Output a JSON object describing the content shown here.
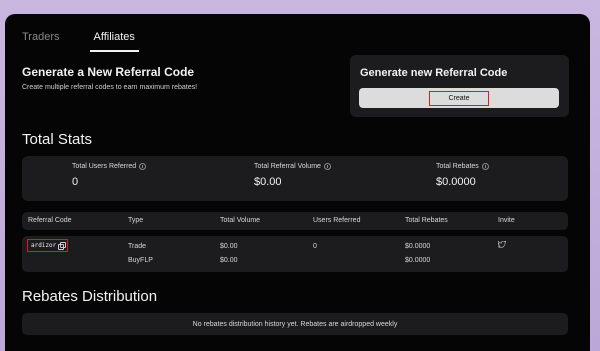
{
  "tabs": {
    "traders": "Traders",
    "affiliates": "Affiliates"
  },
  "generate": {
    "title": "Generate a New Referral Code",
    "subtitle": "Create multiple referral codes to earn maximum rebates!",
    "card_title": "Generate new Referral Code",
    "button_label": "Create"
  },
  "stats": {
    "title": "Total Stats",
    "items": [
      {
        "label": "Total Users Referred",
        "value": "0"
      },
      {
        "label": "Total Referral Volume",
        "value": "$0.00"
      },
      {
        "label": "Total Rebates",
        "value": "$0.0000"
      }
    ]
  },
  "table": {
    "headers": [
      "Referral Code",
      "Type",
      "Total Volume",
      "Users Referred",
      "Total Rebates",
      "Invite"
    ],
    "row": {
      "code": "ardizor",
      "types": [
        "Trade",
        "BuyFLP"
      ],
      "volumes": [
        "$0.00",
        "$0.00"
      ],
      "users": "0",
      "rebates": [
        "$0.0000",
        "$0.0000"
      ],
      "invite_icon": "twitter-icon"
    }
  },
  "rebates": {
    "title": "Rebates Distribution",
    "empty_text": "No rebates distribution history yet. Rebates are airdropped weekly"
  },
  "colors": {
    "highlight": "#d91e1e",
    "card_bg": "#1c1c1e",
    "page_bg": "#050505"
  }
}
